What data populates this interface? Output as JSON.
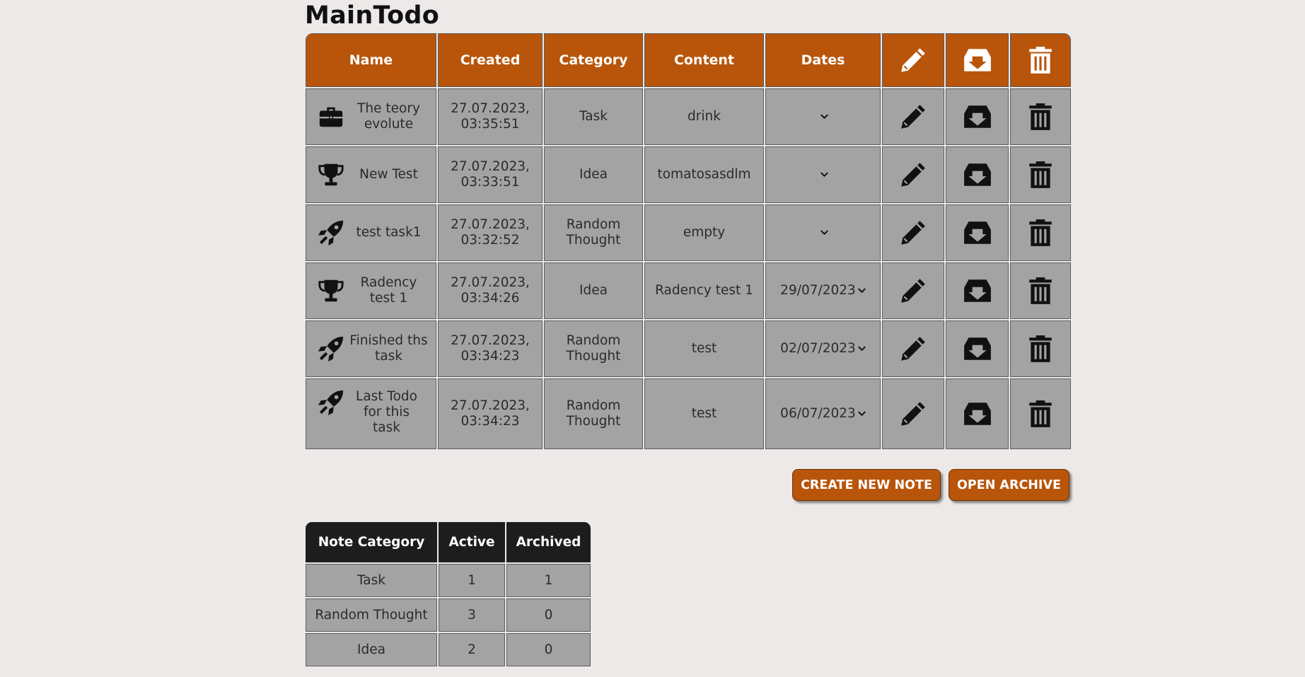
{
  "page": {
    "title": "MainTodo"
  },
  "colors": {
    "accent": "#b8550a",
    "row_bg": "#a3a3a3",
    "page_bg": "#ede9e9",
    "stats_header": "#1d1d1d"
  },
  "main_table": {
    "headers": {
      "name": "Name",
      "created": "Created",
      "category": "Category",
      "content": "Content",
      "dates": "Dates",
      "edit_icon": "pencil-icon",
      "archive_icon": "archive-box-icon",
      "delete_icon": "trash-icon"
    },
    "rows": [
      {
        "icon": "briefcase-icon",
        "name": "The teory evolute",
        "created_date": "27.07.2023,",
        "created_time": "03:35:51",
        "category": "Task",
        "content": "drink",
        "dates": ""
      },
      {
        "icon": "trophy-icon",
        "name": "New Test",
        "created_date": "27.07.2023,",
        "created_time": "03:33:51",
        "category": "Idea",
        "content": "tomatosasdlm",
        "dates": ""
      },
      {
        "icon": "rocket-icon",
        "name": "test task1",
        "created_date": "27.07.2023,",
        "created_time": "03:32:52",
        "category": "Random Thought",
        "content": "empty",
        "dates": ""
      },
      {
        "icon": "trophy-icon",
        "name": "Radency test 1",
        "created_date": "27.07.2023,",
        "created_time": "03:34:26",
        "category": "Idea",
        "content": "Radency test 1",
        "dates": "29/07/2023"
      },
      {
        "icon": "rocket-icon",
        "name": "Finished ths task",
        "created_date": "27.07.2023,",
        "created_time": "03:34:23",
        "category": "Random Thought",
        "content": "test",
        "dates": "02/07/2023"
      },
      {
        "icon": "rocket-icon",
        "name": "Last Todo for this task",
        "created_date": "27.07.2023,",
        "created_time": "03:34:23",
        "category": "Random Thought",
        "content": "test",
        "dates": "06/07/2023"
      }
    ]
  },
  "actions": {
    "create_label": "Create New Note",
    "archive_label": "Open Archive"
  },
  "stats_table": {
    "headers": {
      "category": "Note Category",
      "active": "Active",
      "archived": "Archived"
    },
    "rows": [
      {
        "category": "Task",
        "active": "1",
        "archived": "1"
      },
      {
        "category": "Random Thought",
        "active": "3",
        "archived": "0"
      },
      {
        "category": "Idea",
        "active": "2",
        "archived": "0"
      }
    ]
  }
}
